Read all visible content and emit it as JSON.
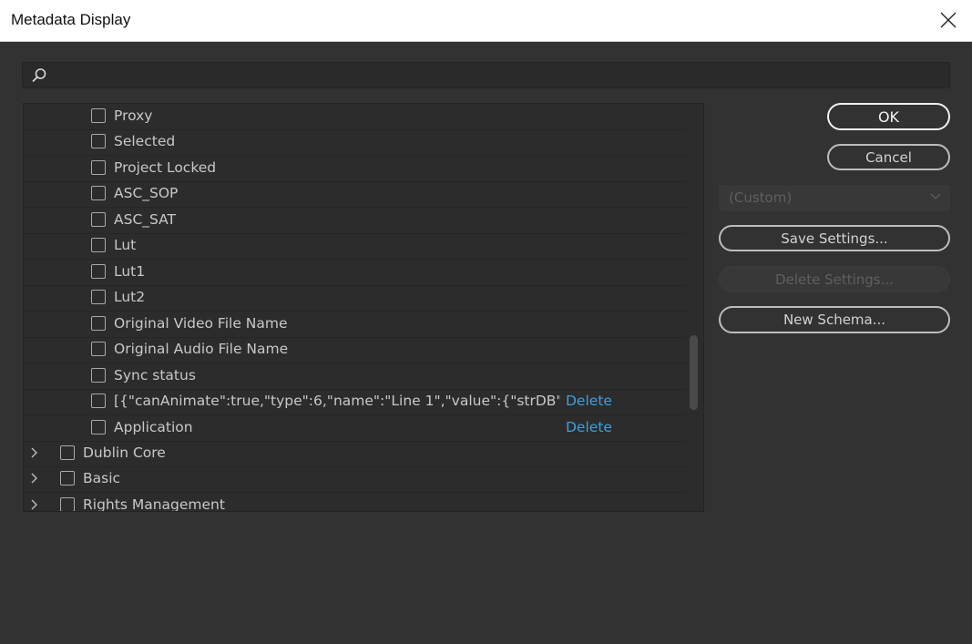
{
  "window": {
    "title": "Metadata Display"
  },
  "search": {
    "value": "",
    "placeholder": ""
  },
  "list": {
    "items": [
      {
        "label": "Proxy",
        "delete": ""
      },
      {
        "label": "Selected",
        "delete": ""
      },
      {
        "label": "Project Locked",
        "delete": ""
      },
      {
        "label": "ASC_SOP",
        "delete": ""
      },
      {
        "label": "ASC_SAT",
        "delete": ""
      },
      {
        "label": "Lut",
        "delete": ""
      },
      {
        "label": "Lut1",
        "delete": ""
      },
      {
        "label": "Lut2",
        "delete": ""
      },
      {
        "label": "Original Video File Name",
        "delete": ""
      },
      {
        "label": "Original Audio File Name",
        "delete": ""
      },
      {
        "label": "Sync status",
        "delete": ""
      },
      {
        "label": "[{\"canAnimate\":true,\"type\":6,\"name\":\"Line 1\",\"value\":{\"strDB\":[{\"locale\"",
        "delete": "Delete"
      },
      {
        "label": "Application",
        "delete": "Delete"
      }
    ],
    "groups": [
      {
        "label": "Dublin Core"
      },
      {
        "label": "Basic"
      },
      {
        "label": "Rights Management"
      }
    ]
  },
  "buttons": {
    "ok": "OK",
    "cancel": "Cancel",
    "save_settings": "Save Settings...",
    "delete_settings": "Delete Settings...",
    "new_schema": "New Schema..."
  },
  "preset": {
    "selected": "(Custom)"
  },
  "colors": {
    "background": "#323232",
    "link": "#3e9fe0",
    "titlebar": "#ffffff"
  }
}
